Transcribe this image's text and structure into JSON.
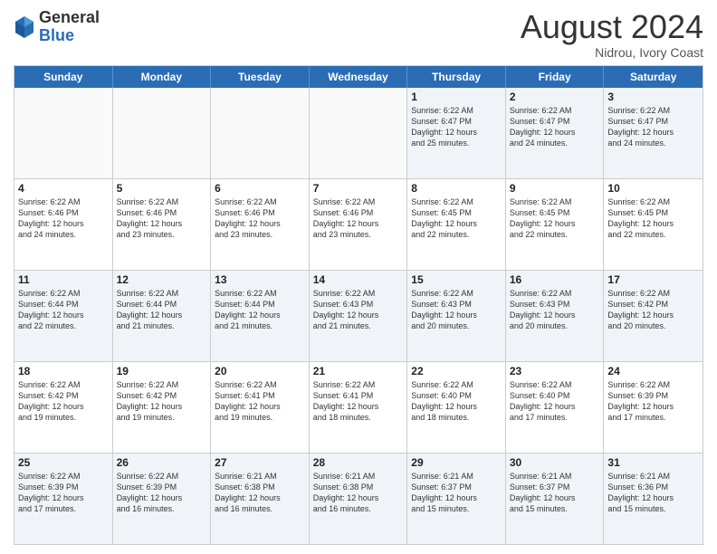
{
  "header": {
    "logo_general": "General",
    "logo_blue": "Blue",
    "title": "August 2024",
    "subtitle": "Nidrou, Ivory Coast"
  },
  "calendar": {
    "weekdays": [
      "Sunday",
      "Monday",
      "Tuesday",
      "Wednesday",
      "Thursday",
      "Friday",
      "Saturday"
    ],
    "weeks": [
      [
        {
          "day": "",
          "info": ""
        },
        {
          "day": "",
          "info": ""
        },
        {
          "day": "",
          "info": ""
        },
        {
          "day": "",
          "info": ""
        },
        {
          "day": "1",
          "info": "Sunrise: 6:22 AM\nSunset: 6:47 PM\nDaylight: 12 hours\nand 25 minutes."
        },
        {
          "day": "2",
          "info": "Sunrise: 6:22 AM\nSunset: 6:47 PM\nDaylight: 12 hours\nand 24 minutes."
        },
        {
          "day": "3",
          "info": "Sunrise: 6:22 AM\nSunset: 6:47 PM\nDaylight: 12 hours\nand 24 minutes."
        }
      ],
      [
        {
          "day": "4",
          "info": "Sunrise: 6:22 AM\nSunset: 6:46 PM\nDaylight: 12 hours\nand 24 minutes."
        },
        {
          "day": "5",
          "info": "Sunrise: 6:22 AM\nSunset: 6:46 PM\nDaylight: 12 hours\nand 23 minutes."
        },
        {
          "day": "6",
          "info": "Sunrise: 6:22 AM\nSunset: 6:46 PM\nDaylight: 12 hours\nand 23 minutes."
        },
        {
          "day": "7",
          "info": "Sunrise: 6:22 AM\nSunset: 6:46 PM\nDaylight: 12 hours\nand 23 minutes."
        },
        {
          "day": "8",
          "info": "Sunrise: 6:22 AM\nSunset: 6:45 PM\nDaylight: 12 hours\nand 22 minutes."
        },
        {
          "day": "9",
          "info": "Sunrise: 6:22 AM\nSunset: 6:45 PM\nDaylight: 12 hours\nand 22 minutes."
        },
        {
          "day": "10",
          "info": "Sunrise: 6:22 AM\nSunset: 6:45 PM\nDaylight: 12 hours\nand 22 minutes."
        }
      ],
      [
        {
          "day": "11",
          "info": "Sunrise: 6:22 AM\nSunset: 6:44 PM\nDaylight: 12 hours\nand 22 minutes."
        },
        {
          "day": "12",
          "info": "Sunrise: 6:22 AM\nSunset: 6:44 PM\nDaylight: 12 hours\nand 21 minutes."
        },
        {
          "day": "13",
          "info": "Sunrise: 6:22 AM\nSunset: 6:44 PM\nDaylight: 12 hours\nand 21 minutes."
        },
        {
          "day": "14",
          "info": "Sunrise: 6:22 AM\nSunset: 6:43 PM\nDaylight: 12 hours\nand 21 minutes."
        },
        {
          "day": "15",
          "info": "Sunrise: 6:22 AM\nSunset: 6:43 PM\nDaylight: 12 hours\nand 20 minutes."
        },
        {
          "day": "16",
          "info": "Sunrise: 6:22 AM\nSunset: 6:43 PM\nDaylight: 12 hours\nand 20 minutes."
        },
        {
          "day": "17",
          "info": "Sunrise: 6:22 AM\nSunset: 6:42 PM\nDaylight: 12 hours\nand 20 minutes."
        }
      ],
      [
        {
          "day": "18",
          "info": "Sunrise: 6:22 AM\nSunset: 6:42 PM\nDaylight: 12 hours\nand 19 minutes."
        },
        {
          "day": "19",
          "info": "Sunrise: 6:22 AM\nSunset: 6:42 PM\nDaylight: 12 hours\nand 19 minutes."
        },
        {
          "day": "20",
          "info": "Sunrise: 6:22 AM\nSunset: 6:41 PM\nDaylight: 12 hours\nand 19 minutes."
        },
        {
          "day": "21",
          "info": "Sunrise: 6:22 AM\nSunset: 6:41 PM\nDaylight: 12 hours\nand 18 minutes."
        },
        {
          "day": "22",
          "info": "Sunrise: 6:22 AM\nSunset: 6:40 PM\nDaylight: 12 hours\nand 18 minutes."
        },
        {
          "day": "23",
          "info": "Sunrise: 6:22 AM\nSunset: 6:40 PM\nDaylight: 12 hours\nand 17 minutes."
        },
        {
          "day": "24",
          "info": "Sunrise: 6:22 AM\nSunset: 6:39 PM\nDaylight: 12 hours\nand 17 minutes."
        }
      ],
      [
        {
          "day": "25",
          "info": "Sunrise: 6:22 AM\nSunset: 6:39 PM\nDaylight: 12 hours\nand 17 minutes."
        },
        {
          "day": "26",
          "info": "Sunrise: 6:22 AM\nSunset: 6:39 PM\nDaylight: 12 hours\nand 16 minutes."
        },
        {
          "day": "27",
          "info": "Sunrise: 6:21 AM\nSunset: 6:38 PM\nDaylight: 12 hours\nand 16 minutes."
        },
        {
          "day": "28",
          "info": "Sunrise: 6:21 AM\nSunset: 6:38 PM\nDaylight: 12 hours\nand 16 minutes."
        },
        {
          "day": "29",
          "info": "Sunrise: 6:21 AM\nSunset: 6:37 PM\nDaylight: 12 hours\nand 15 minutes."
        },
        {
          "day": "30",
          "info": "Sunrise: 6:21 AM\nSunset: 6:37 PM\nDaylight: 12 hours\nand 15 minutes."
        },
        {
          "day": "31",
          "info": "Sunrise: 6:21 AM\nSunset: 6:36 PM\nDaylight: 12 hours\nand 15 minutes."
        }
      ]
    ]
  }
}
